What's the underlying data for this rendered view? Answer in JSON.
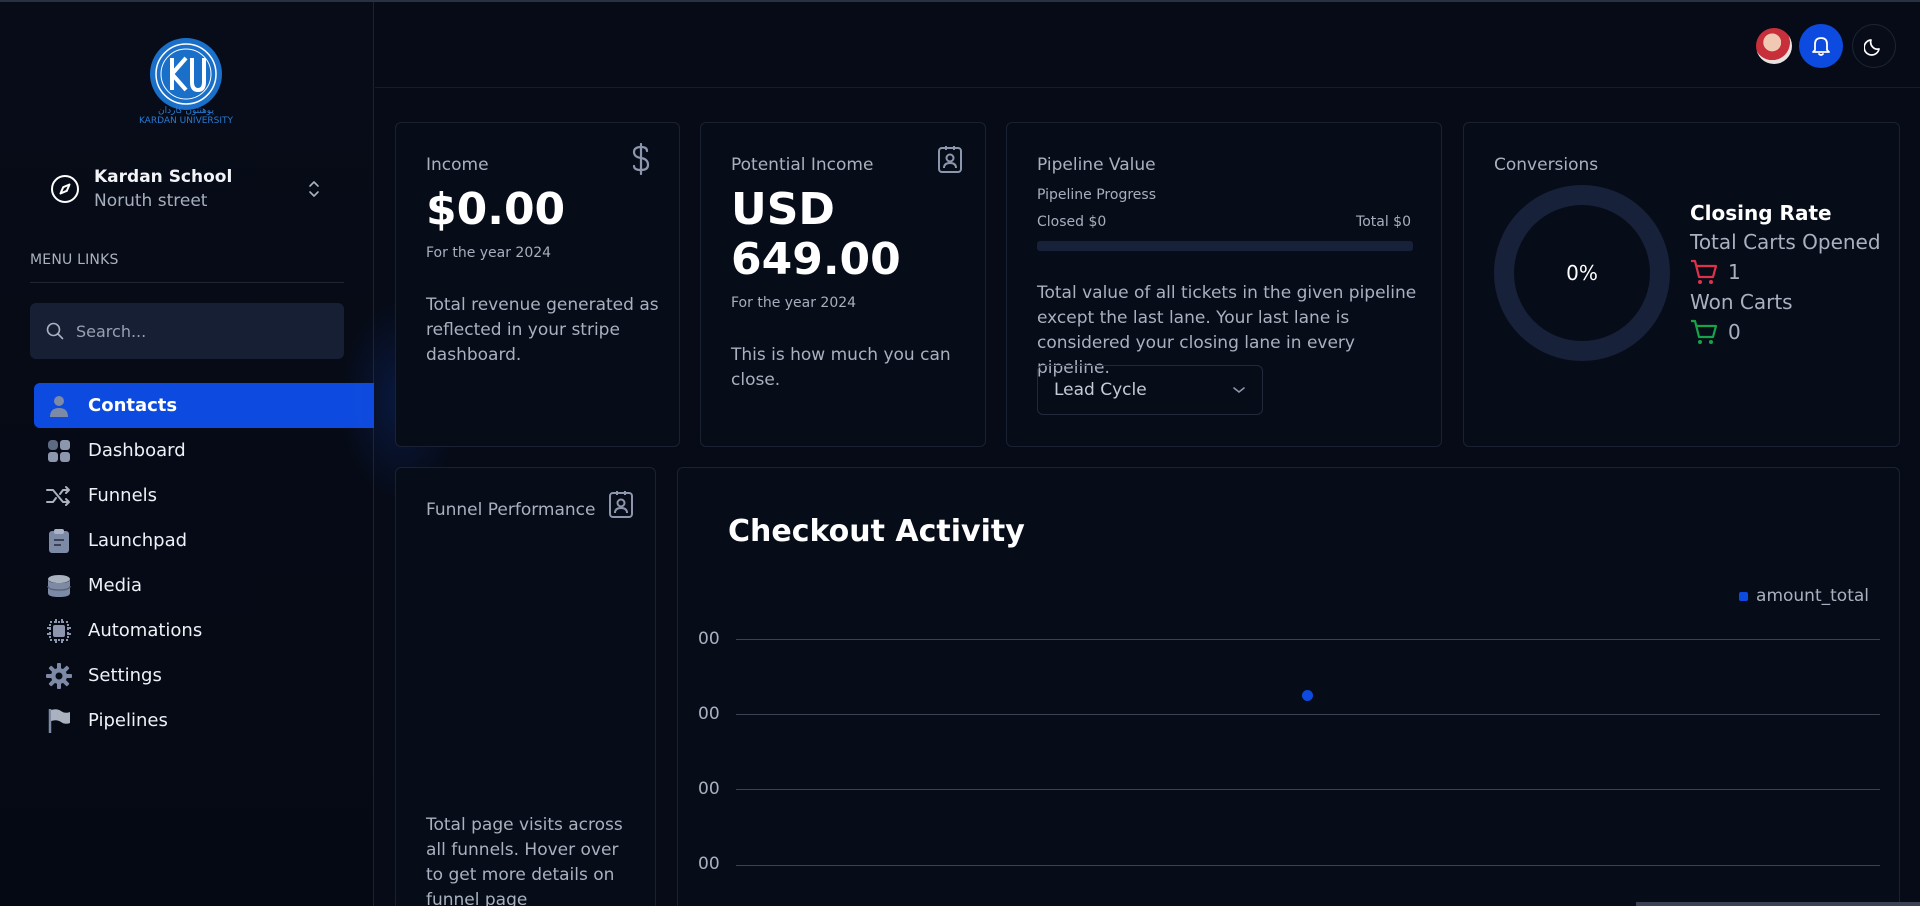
{
  "brand": {
    "logo_text": "KARDAN UNIVERSITY",
    "logo_persian": "پوهنتون کاردان",
    "logo_letters": "KU"
  },
  "workspace": {
    "name": "Kardan School",
    "address": "Noruth street"
  },
  "sidebar": {
    "menu_label": "MENU LINKS",
    "search_placeholder": "Search...",
    "items": [
      {
        "label": "Contacts",
        "icon": "person-icon",
        "active": true
      },
      {
        "label": "Dashboard",
        "icon": "grid-icon",
        "active": false
      },
      {
        "label": "Funnels",
        "icon": "shuffle-icon",
        "active": false
      },
      {
        "label": "Launchpad",
        "icon": "clipboard-icon",
        "active": false
      },
      {
        "label": "Media",
        "icon": "database-icon",
        "active": false
      },
      {
        "label": "Automations",
        "icon": "chip-icon",
        "active": false
      },
      {
        "label": "Settings",
        "icon": "gear-icon",
        "active": false
      },
      {
        "label": "Pipelines",
        "icon": "flag-icon",
        "active": false
      }
    ]
  },
  "cards": {
    "income": {
      "title": "Income",
      "value": "$0.00",
      "year": "For the year 2024",
      "desc": "Total revenue generated as reflected in your stripe dashboard."
    },
    "potential": {
      "title": "Potential Income",
      "value_line1": "USD",
      "value_line2": "649.00",
      "year": "For the year 2024",
      "desc": "This is how much you can close."
    },
    "pipeline": {
      "title": "Pipeline Value",
      "progress_label": "Pipeline Progress",
      "closed": "Closed $0",
      "total": "Total $0",
      "progress_fraction": 0,
      "desc": "Total value of all tickets in the given pipeline except the last lane. Your last lane is considered your closing lane in every pipeline.",
      "select_value": "Lead Cycle"
    },
    "conversions": {
      "title": "Conversions",
      "donut_label": "0%",
      "closing_rate": "Closing Rate",
      "total_carts_label": "Total Carts Opened",
      "total_carts_value": "1",
      "won_carts_label": "Won Carts",
      "won_carts_value": "0"
    },
    "funnel": {
      "title": "Funnel Performance",
      "desc": "Total page visits across all funnels. Hover over to get more details on funnel page"
    },
    "activity": {
      "title": "Checkout Activity",
      "legend": "amount_total",
      "y_ticks": [
        "00",
        "00",
        "00",
        "00"
      ]
    }
  },
  "colors": {
    "accent": "#0d4be0",
    "cart_red": "#e0314b",
    "cart_green": "#17a34a"
  }
}
